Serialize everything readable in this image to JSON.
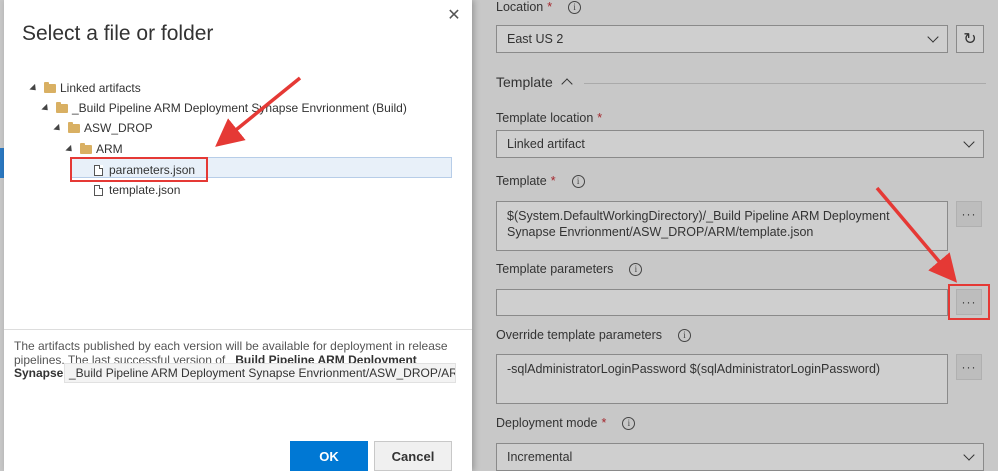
{
  "modal": {
    "title": "Select a file or folder",
    "close_glyph": "✕",
    "tree": [
      {
        "label": "Linked artifacts",
        "type": "folder",
        "level": 0
      },
      {
        "label": "_Build Pipeline ARM Deployment Synapse Envrionment (Build)",
        "type": "folder",
        "level": 1
      },
      {
        "label": "ASW_DROP",
        "type": "folder",
        "level": 2
      },
      {
        "label": "ARM",
        "type": "folder",
        "level": 3
      },
      {
        "label": "parameters.json",
        "type": "file",
        "level": 4,
        "selected": true
      },
      {
        "label": "template.json",
        "type": "file",
        "level": 4
      }
    ],
    "description_prefix": "The artifacts published by each version will be available for deployment in release pipelines. The last successful version of ",
    "description_bold": "_Build Pipeline ARM Deployment",
    "path_label": "Synapse",
    "path_value": "_Build Pipeline ARM Deployment Synapse Envrionment/ASW_DROP/ARM",
    "ok_label": "OK",
    "cancel_label": "Cancel"
  },
  "form": {
    "location": {
      "label": "Location",
      "value": "East US 2"
    },
    "template_section": {
      "label": "Template"
    },
    "template_location": {
      "label": "Template location",
      "value": "Linked artifact"
    },
    "template": {
      "label": "Template",
      "value": "$(System.DefaultWorkingDirectory)/_Build Pipeline ARM Deployment Synapse Envrionment/ASW_DROP/ARM/template.json"
    },
    "template_parameters": {
      "label": "Template parameters",
      "value": ""
    },
    "override_parameters": {
      "label": "Override template parameters",
      "value": "-sqlAdministratorLoginPassword $(sqlAdministratorLoginPassword)"
    },
    "deployment_mode": {
      "label": "Deployment mode",
      "value": "Incremental"
    },
    "required_mark": "*",
    "info_glyph": "i",
    "ellipsis": "···",
    "refresh_glyph": "↻"
  },
  "colors": {
    "accent": "#0078d4",
    "annotation_red": "#e53935",
    "folder": "#d9b063",
    "overlay_gray": "#c8c8c8"
  }
}
